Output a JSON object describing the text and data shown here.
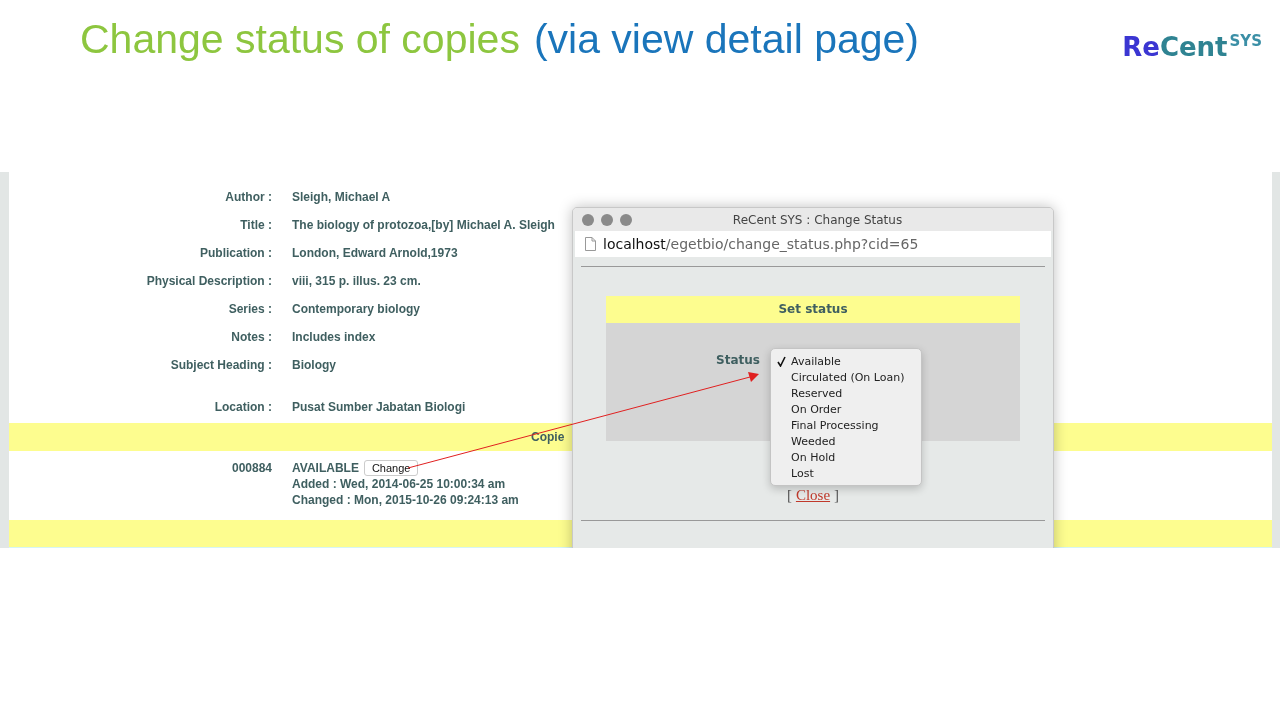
{
  "slide": {
    "title": "Change status of copies",
    "subtitle": "(via view detail page)",
    "logo": {
      "parts": [
        "Re",
        "Cent"
      ],
      "sup": "SYS"
    }
  },
  "record": {
    "fields": [
      {
        "label": "Author :",
        "value": "Sleigh, Michael A"
      },
      {
        "label": "Title :",
        "value": "The biology of protozoa,[by] Michael A. Sleigh"
      },
      {
        "label": "Publication :",
        "value": "London, Edward Arnold,1973"
      },
      {
        "label": "Physical Description :",
        "value": "viii, 315 p. illus. 23 cm."
      },
      {
        "label": "Series :",
        "value": "Contemporary biology"
      },
      {
        "label": "Notes :",
        "value": "Includes index"
      },
      {
        "label": "Subject Heading :",
        "value": "Biology"
      },
      {
        "label": "Location :",
        "value": "Pusat Sumber Jabatan Biologi"
      }
    ],
    "copies_heading": "Copie",
    "copy": {
      "number": "000884",
      "status": "AVAILABLE",
      "button": "Change",
      "added": "Added : Wed, 2014-06-25 10:00:34 am",
      "changed": "Changed : Mon, 2015-10-26 09:24:13 am"
    }
  },
  "popup": {
    "title": "ReCent SYS : Change Status",
    "url_host": "localhost",
    "url_path": "/egetbio/change_status.php?cid=65",
    "heading": "Set status",
    "status_label": "Status",
    "options": [
      {
        "label": "Available",
        "selected": true
      },
      {
        "label": "Circulated (On Loan)",
        "selected": false
      },
      {
        "label": "Reserved",
        "selected": false
      },
      {
        "label": "On Order",
        "selected": false
      },
      {
        "label": "Final Processing",
        "selected": false
      },
      {
        "label": "Weeded",
        "selected": false
      },
      {
        "label": "On Hold",
        "selected": false
      },
      {
        "label": "Lost",
        "selected": false
      }
    ],
    "close_open": "[",
    "close": "Close",
    "close_end": "]"
  }
}
